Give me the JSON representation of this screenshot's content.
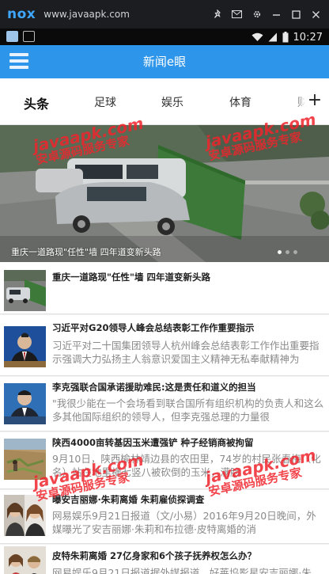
{
  "emulator": {
    "logo": "nox",
    "url": "www.javaapk.com",
    "tools": [
      "pin-icon",
      "mail-icon",
      "gear-icon",
      "minimize-icon",
      "maximize-icon",
      "close-icon"
    ]
  },
  "status_bar": {
    "time": "10:27"
  },
  "header": {
    "title": "新闻e眼",
    "accent": "#2d95ea"
  },
  "tabs": [
    "头条",
    "足球",
    "娱乐",
    "体育",
    "财"
  ],
  "banner": {
    "caption": "重庆一道路现\"任性\"墙 四年道变新头路"
  },
  "news": [
    {
      "title": "重庆一道路现\"任性\"墙 四年道变新头路",
      "digest": ""
    },
    {
      "title": "习近平对G20领导人峰会总结表彰工作作重要指示",
      "digest": "习近平对二十国集团领导人杭州峰会总结表彰工作作出重要指示强调大力弘扬主人翁意识爱国主义精神无私奉献精神为"
    },
    {
      "title": "李克强联合国承诺援助难民:这是责任和道义的担当",
      "digest": "\"我很少能在一个会场看到联合国所有组织机构的负责人和这么多其他国际组织的领导人，但李克强总理的力量很"
    },
    {
      "title": "陕西4000亩转基因玉米遭强铲 种子经销商被拘留",
      "digest": "9月10日，陕西榆林靖边县的农田里，74岁的村民张春梅（化名）站在地里横七竖八被砍倒的玉米，满脸"
    },
    {
      "title": "曝安吉丽娜·朱莉离婚 朱莉雇侦探调查",
      "digest": "网易娱乐9月21日报道（文/小易）2016年9月20日晚间，外媒曝光了安吉丽娜·朱莉和布拉德·皮特离婚的消"
    },
    {
      "title": "皮特朱莉离婚 27亿身家和6个孩子抚养权怎么办？",
      "digest": "网易娱乐9月21日报道据外媒报道，好莱坞影星安吉丽娜·朱"
    }
  ],
  "watermark": {
    "line1": "javaapk.com",
    "line2": "安卓源码服务专家",
    "color": "#f0242c"
  }
}
